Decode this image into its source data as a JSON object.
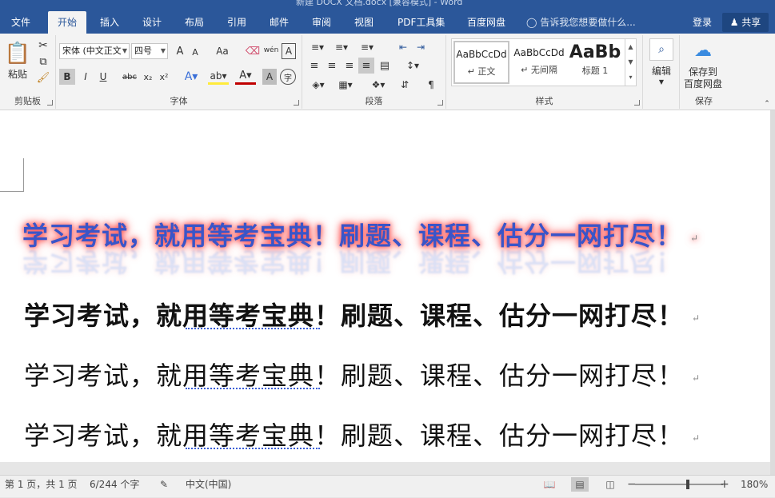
{
  "window": {
    "title": "新建 DOCX 文档.docx [兼容模式] - Word"
  },
  "tabs": [
    {
      "label": "文件"
    },
    {
      "label": "开始"
    },
    {
      "label": "插入"
    },
    {
      "label": "设计"
    },
    {
      "label": "布局"
    },
    {
      "label": "引用"
    },
    {
      "label": "邮件"
    },
    {
      "label": "审阅"
    },
    {
      "label": "视图"
    },
    {
      "label": "PDF工具集"
    },
    {
      "label": "百度网盘"
    }
  ],
  "tellme": {
    "text": "告诉我您想要做什么..."
  },
  "account": {
    "login": "登录",
    "share": "共享"
  },
  "ribbon": {
    "clipboard": {
      "paste": "粘贴",
      "label": "剪贴板"
    },
    "font": {
      "font_name": "宋体 (中文正文",
      "font_size": "四号",
      "bold": "B",
      "italic": "I",
      "underline": "U",
      "strike": "abc",
      "subscript": "x₂",
      "superscript": "x²",
      "grow": "A",
      "shrink": "A",
      "case": "Aa",
      "phonetic": "wén",
      "label": "字体"
    },
    "paragraph": {
      "label": "段落"
    },
    "styles": {
      "items": [
        {
          "preview": "AaBbCcDd",
          "name": "↵ 正文"
        },
        {
          "preview": "AaBbCcDd",
          "name": "↵ 无间隔"
        },
        {
          "preview": "AaBb",
          "name": "标题 1"
        }
      ],
      "label": "样式"
    },
    "editing": {
      "label": "编辑"
    },
    "save": {
      "line1": "保存到",
      "line2": "百度网盘",
      "label": "保存"
    }
  },
  "document": {
    "fancy_line": "学习考试，就用等考宝典！刷题、课程、估分一网打尽！",
    "lines": [
      "学习考试，就用等考宝典！刷题、课程、估分一网打尽！",
      "学习考试，就用等考宝典！刷题、课程、估分一网打尽！",
      "学习考试，就用等考宝典！刷题、课程、估分一网打尽！"
    ],
    "para_mark": "↵"
  },
  "status": {
    "page": "第 1 页，共 1 页",
    "words": "6/244 个字",
    "language": "中文(中国)",
    "zoom_level": "180%",
    "zoom_fraction": 0.6
  },
  "colors": {
    "accent": "#2b579a"
  },
  "icons": [
    "paste-icon",
    "cut-icon",
    "copy-icon",
    "format-painter-icon",
    "find-icon",
    "baidu-cloud-icon",
    "share-person-icon",
    "lightbulb-icon",
    "read-mode-icon",
    "print-layout-icon",
    "web-layout-icon"
  ]
}
